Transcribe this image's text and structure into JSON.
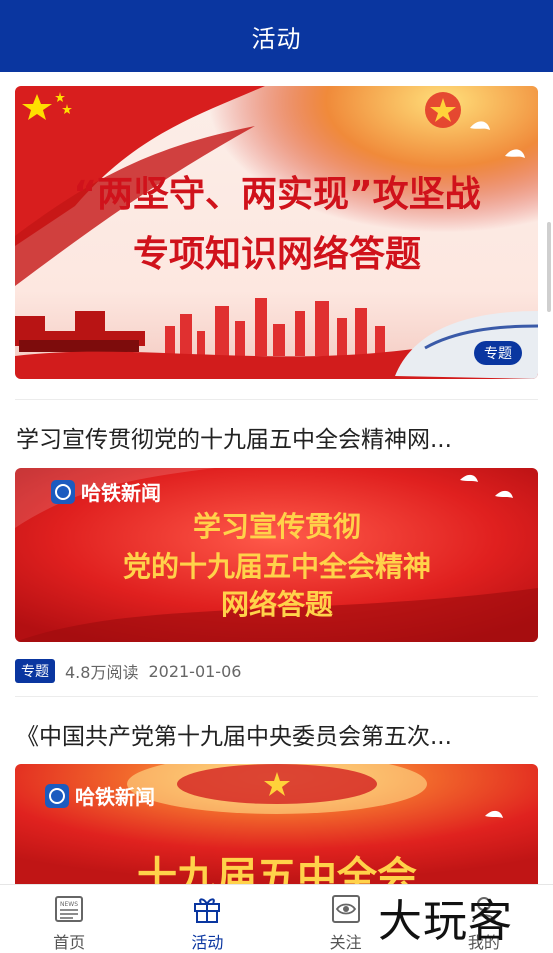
{
  "header": {
    "title": "活动"
  },
  "articles": [
    {
      "banner_lines": [
        "“两坚守、两实现”攻坚战",
        "专项知识网络答题"
      ],
      "tag": "专题"
    },
    {
      "title": "学习宣传贯彻党的十九届五中全会精神网...",
      "banner_brand": "哈铁新闻",
      "banner_lines": [
        "学习宣传贯彻",
        "党的十九届五中全会精神",
        "网络答题"
      ],
      "tag": "专题",
      "reads": "4.8万阅读",
      "date": "2021-01-06"
    },
    {
      "title": "《中国共产党第十九届中央委员会第五次...",
      "banner_brand": "哈铁新闻",
      "banner_lines": [
        "十九届五中全会"
      ]
    }
  ],
  "tabbar": {
    "items": [
      {
        "label": "首页",
        "icon": "news-icon"
      },
      {
        "label": "活动",
        "icon": "gift-icon"
      },
      {
        "label": "关注",
        "icon": "eye-icon"
      },
      {
        "label": "我的",
        "icon": "profile-icon"
      }
    ],
    "active_color": "#0a36a0"
  },
  "watermark": "大玩客",
  "colors": {
    "brand": "#0a36a0",
    "banner_red": "#d81e1e"
  }
}
